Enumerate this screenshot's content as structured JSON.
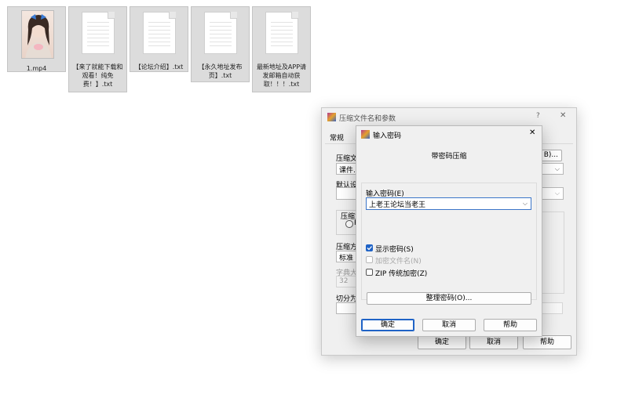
{
  "files": [
    {
      "name": "1.mp4",
      "type": "video"
    },
    {
      "name": "【来了就能下载和观看！纯免费！】.txt",
      "type": "text"
    },
    {
      "name": "【论坛介绍】.txt",
      "type": "text"
    },
    {
      "name": "【永久地址发布页】.txt",
      "type": "text"
    },
    {
      "name": "最新地址及APP请发邮箱自动获取！！！.txt",
      "type": "text"
    }
  ],
  "back_dialog": {
    "title": "压缩文件名和参数",
    "help_glyph": "?",
    "close_glyph": "✕",
    "tab_general": "常规",
    "archive_name_label": "压缩文",
    "archive_name_value": "课件.z",
    "browse_label": "B)...",
    "default_label": "默认设",
    "format_group_label": "压缩文",
    "format_radio_label": "R",
    "method_label": "压缩方",
    "method_value": "标准",
    "dict_label": "字典大",
    "dict_value": "32",
    "split_label": "切分为",
    "ok_label": "确定",
    "cancel_label": "取消",
    "help_label": "帮助"
  },
  "pwd_dialog": {
    "title": "输入密码",
    "close_glyph": "✕",
    "subtitle": "带密码压缩",
    "password_label": "输入密码(E)",
    "password_value": "上老王论坛当老王",
    "show_password": {
      "label": "显示密码(S)",
      "checked": true
    },
    "encrypt_names": {
      "label": "加密文件名(N)",
      "checked": false,
      "disabled": true
    },
    "zip_legacy": {
      "label": "ZIP 传统加密(Z)",
      "checked": false
    },
    "organize_label": "整理密码(O)...",
    "ok_label": "确定",
    "cancel_label": "取消",
    "help_label": "帮助"
  },
  "colors": {
    "accent": "#1f63c6",
    "dialog_bg": "#f0f0f0"
  }
}
